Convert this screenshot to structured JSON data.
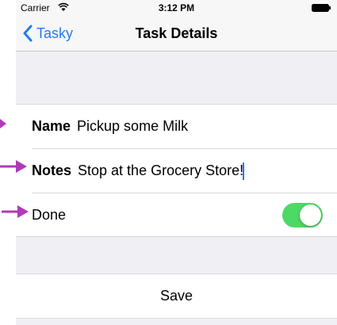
{
  "status_bar": {
    "carrier": "Carrier",
    "time": "3:12 PM",
    "wifi_icon": "wifi-icon",
    "battery_icon": "battery-icon"
  },
  "nav_bar": {
    "back_label": "Tasky",
    "title": "Task Details"
  },
  "form": {
    "name_label": "Name",
    "name_value": "Pickup some Milk",
    "notes_label": "Notes",
    "notes_value": "Stop at the Grocery Store!",
    "done_label": "Done",
    "done_on": true
  },
  "save_label": "Save",
  "colors": {
    "accent": "#1f7bf3",
    "toggle_on": "#4cd964",
    "annotation_arrow": "#b03ab8",
    "grouped_background": "#efeff4"
  }
}
